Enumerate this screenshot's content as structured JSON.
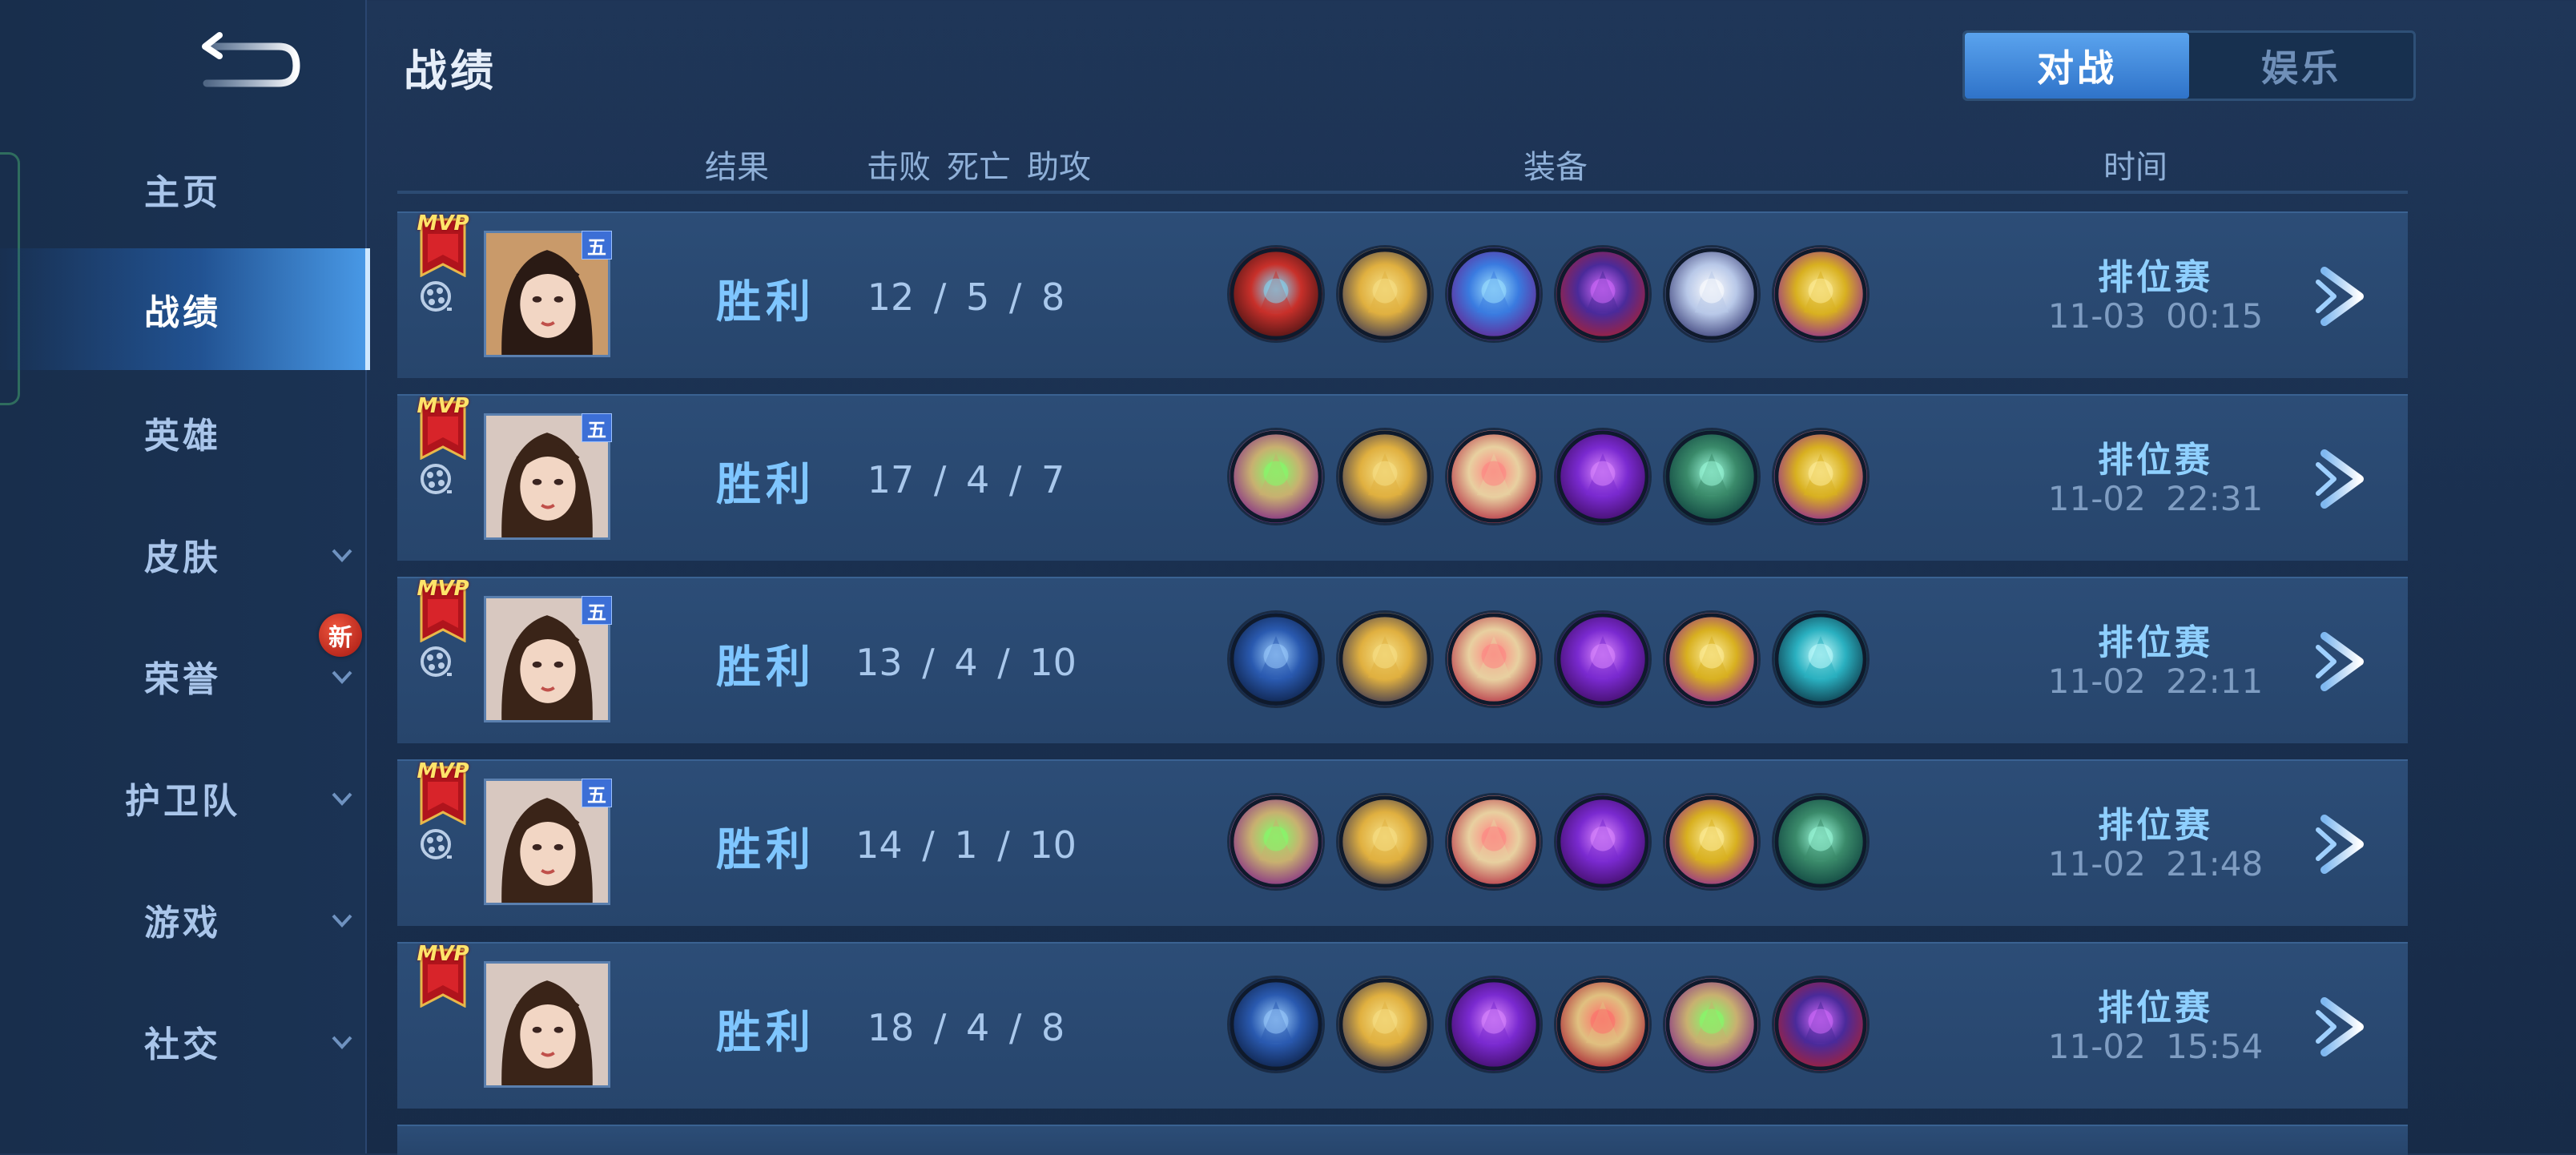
{
  "header": {
    "title": "战绩"
  },
  "tabs": [
    {
      "label": "对战",
      "active": true
    },
    {
      "label": "娱乐",
      "active": false
    }
  ],
  "columns": {
    "result": "结果",
    "kills": "击败",
    "deaths": "死亡",
    "assists": "助攻",
    "equipment": "装备",
    "time": "时间"
  },
  "sidebar": {
    "items": [
      {
        "label": "主页",
        "active": false,
        "expandable": false
      },
      {
        "label": "战绩",
        "active": true,
        "expandable": false
      },
      {
        "label": "英雄",
        "active": false,
        "expandable": false
      },
      {
        "label": "皮肤",
        "active": false,
        "expandable": true
      },
      {
        "label": "荣誉",
        "active": false,
        "expandable": true,
        "badge": "新"
      },
      {
        "label": "护卫队",
        "active": false,
        "expandable": true
      },
      {
        "label": "游戏",
        "active": false,
        "expandable": true
      },
      {
        "label": "社交",
        "active": false,
        "expandable": true
      }
    ]
  },
  "matches": [
    {
      "mvp": "MVP",
      "badge": "五",
      "result": "胜利",
      "kills": "12",
      "deaths": "5",
      "assists": "8",
      "mode": "排位赛",
      "time": "11-03  00:15",
      "hero": "hero-a",
      "items": [
        "red-boots",
        "gold-chalice",
        "blue-dragon",
        "purple-hat",
        "silver-blade",
        "gold-staff"
      ]
    },
    {
      "mvp": "MVP",
      "badge": "五",
      "result": "胜利",
      "kills": "17",
      "deaths": "4",
      "assists": "7",
      "mode": "排位赛",
      "time": "11-02  22:31",
      "hero": "hero-b",
      "items": [
        "green-book",
        "gold-chalice",
        "red-scroll",
        "purple-gem",
        "green-boots",
        "gold-staff"
      ]
    },
    {
      "mvp": "MVP",
      "badge": "五",
      "result": "胜利",
      "kills": "13",
      "deaths": "4",
      "assists": "10",
      "mode": "排位赛",
      "time": "11-02  22:11",
      "hero": "hero-b",
      "items": [
        "blue-boots",
        "gold-chalice",
        "red-scroll",
        "purple-gem",
        "gold-staff",
        "teal-scythe"
      ]
    },
    {
      "mvp": "MVP",
      "badge": "五",
      "result": "胜利",
      "kills": "14",
      "deaths": "1",
      "assists": "10",
      "mode": "排位赛",
      "time": "11-02  21:48",
      "hero": "hero-b",
      "items": [
        "green-book",
        "gold-chalice",
        "red-scroll",
        "purple-gem",
        "gold-staff",
        "green-boots"
      ]
    },
    {
      "mvp": "MVP",
      "badge": "",
      "result": "胜利",
      "kills": "18",
      "deaths": "4",
      "assists": "8",
      "mode": "排位赛",
      "time": "11-02  15:54",
      "hero": "hero-b",
      "items": [
        "blue-boots",
        "gold-chalice",
        "purple-gem",
        "red-book",
        "green-book",
        "purple-hat"
      ]
    }
  ],
  "colors": {
    "accent": "#7fc6ff",
    "tab_active": "#3a86dd",
    "nav_active": "#4aa0ff",
    "badge_new": "#c8301f"
  }
}
